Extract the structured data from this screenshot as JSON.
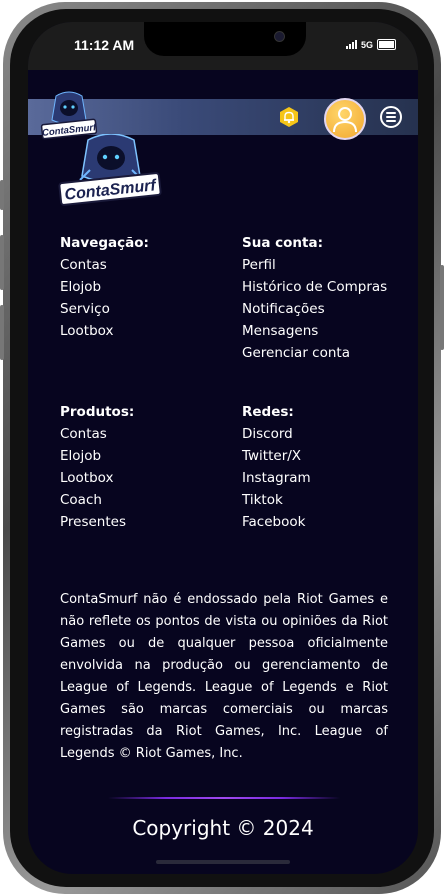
{
  "status": {
    "time": "11:12 AM",
    "network": "5G"
  },
  "brand": {
    "name": "ContaSmurf"
  },
  "header": {
    "bell_icon": "bell-icon",
    "menu_icon": "hamburger-menu-icon",
    "bell_color": "#f5c518",
    "avatar_color": "#f5b53a"
  },
  "nav": {
    "heading": "Navegação:",
    "items": [
      "Contas",
      "Elojob",
      "Serviço",
      "Lootbox"
    ]
  },
  "account": {
    "heading": "Sua conta:",
    "items": [
      "Perfil",
      "Histórico de Compras",
      "Notificações",
      "Mensagens",
      "Gerenciar conta"
    ]
  },
  "products": {
    "heading": "Produtos:",
    "items": [
      "Contas",
      "Elojob",
      "Lootbox",
      "Coach",
      "Presentes"
    ]
  },
  "social": {
    "heading": "Redes:",
    "items": [
      "Discord",
      "Twitter/X",
      "Instagram",
      "Tiktok",
      "Facebook"
    ]
  },
  "disclaimer": "ContaSmurf não é endossado pela Riot Games e não reflete os pontos de vista ou opiniões da Riot Games ou de qualquer pessoa oficialmente envolvida na produção ou gerenciamento de League of Legends. League of Legends e Riot Games são marcas comerciais ou marcas registradas da Riot Games, Inc. League of Legends © Riot Games, Inc.",
  "copyright": "Copyright © 2024",
  "colors": {
    "background": "#07051f",
    "accent": "#8a3ae8"
  }
}
